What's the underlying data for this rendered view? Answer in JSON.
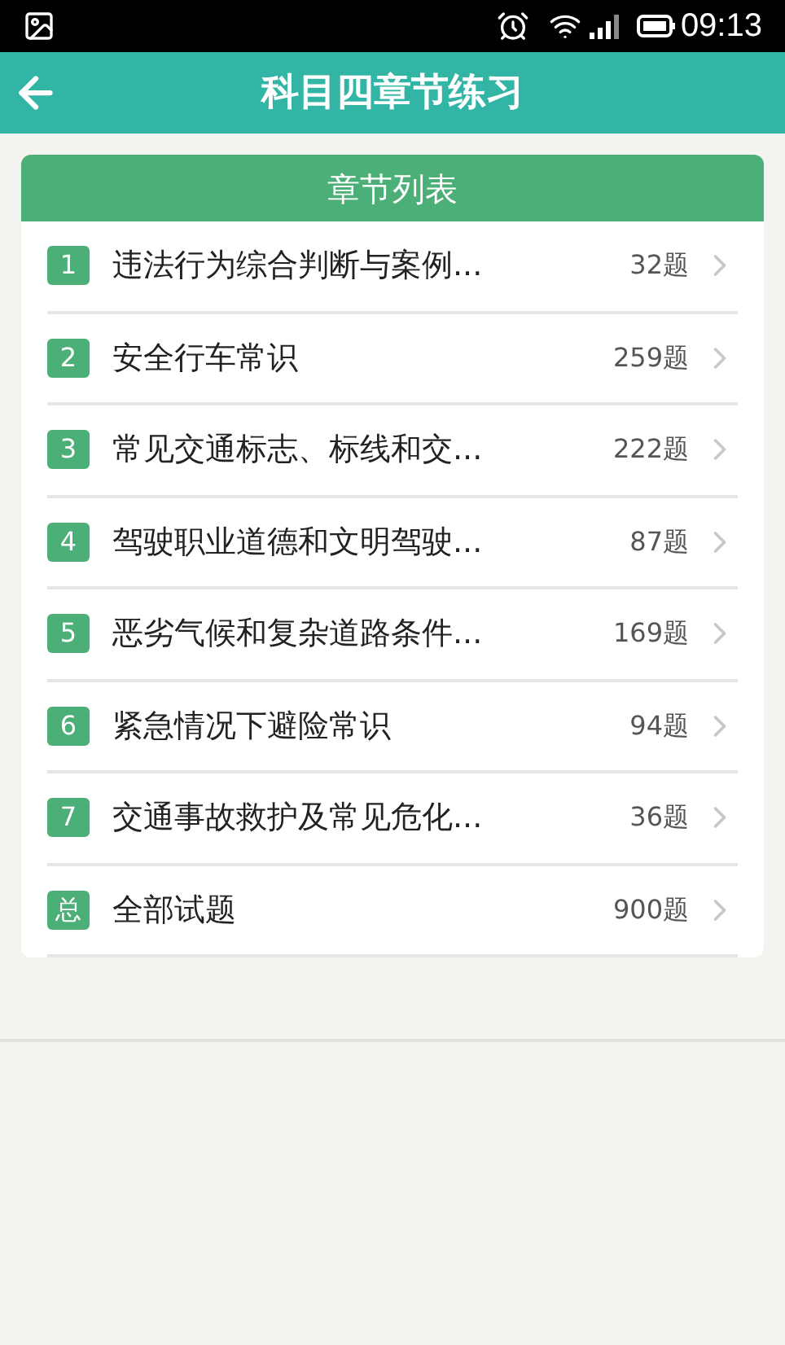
{
  "status_bar": {
    "time": "09:13"
  },
  "header": {
    "title": "科目四章节练习"
  },
  "list": {
    "title": "章节列表",
    "items": [
      {
        "badge": "1",
        "label": "违法行为综合判断与案例...",
        "count": "32题"
      },
      {
        "badge": "2",
        "label": "安全行车常识",
        "count": "259题"
      },
      {
        "badge": "3",
        "label": "常见交通标志、标线和交...",
        "count": "222题"
      },
      {
        "badge": "4",
        "label": "驾驶职业道德和文明驾驶...",
        "count": "87题"
      },
      {
        "badge": "5",
        "label": "恶劣气候和复杂道路条件...",
        "count": "169题"
      },
      {
        "badge": "6",
        "label": "紧急情况下避险常识",
        "count": "94题"
      },
      {
        "badge": "7",
        "label": "交通事故救护及常见危化...",
        "count": "36题"
      },
      {
        "badge": "总",
        "label": "全部试题",
        "count": "900题"
      }
    ]
  }
}
